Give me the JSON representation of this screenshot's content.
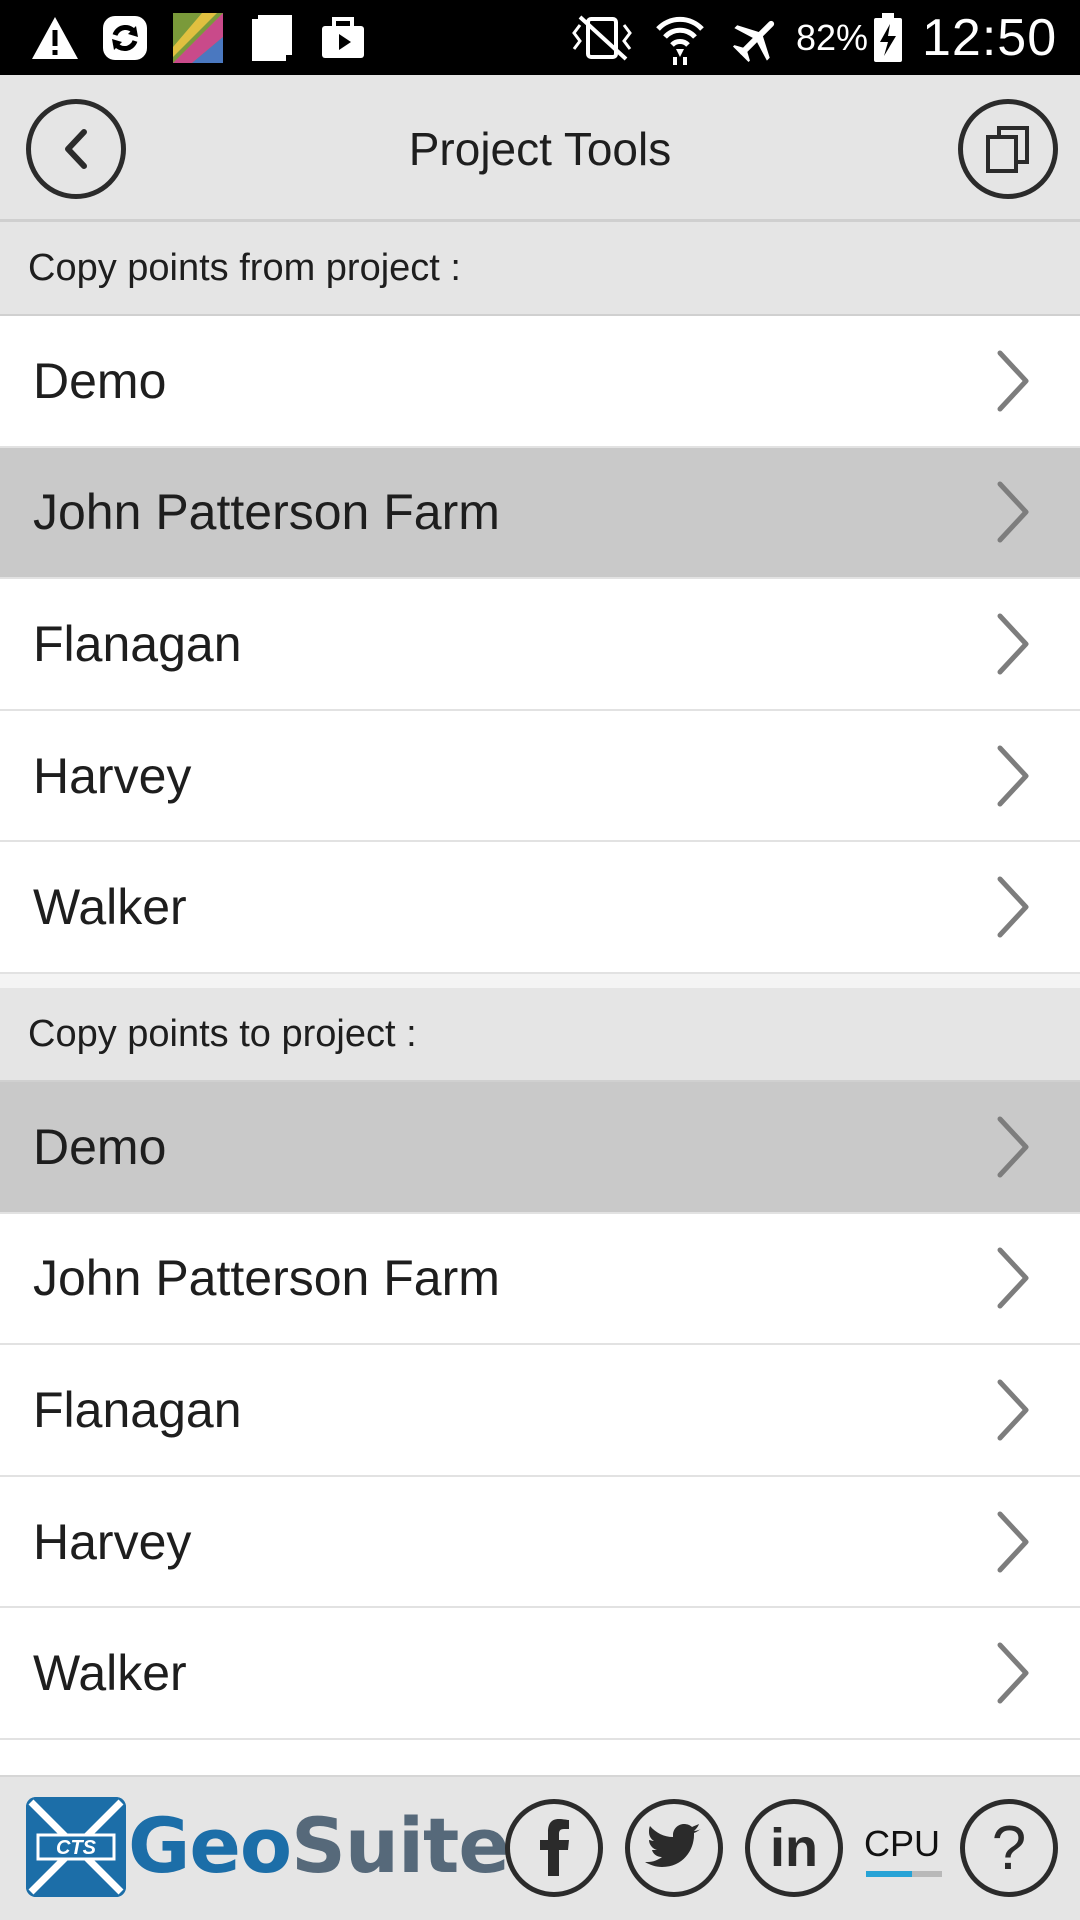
{
  "status_bar": {
    "battery_percent": "82%",
    "time": "12:50"
  },
  "header": {
    "title": "Project Tools"
  },
  "copy_from": {
    "heading": "Copy points from project :",
    "selected_index": 1,
    "items": [
      {
        "label": "Demo"
      },
      {
        "label": "John Patterson Farm"
      },
      {
        "label": "Flanagan"
      },
      {
        "label": "Harvey"
      },
      {
        "label": "Walker"
      }
    ]
  },
  "copy_to": {
    "heading": "Copy points to project :",
    "selected_index": 0,
    "items": [
      {
        "label": "Demo"
      },
      {
        "label": "John Patterson Farm"
      },
      {
        "label": "Flanagan"
      },
      {
        "label": "Harvey"
      },
      {
        "label": "Walker"
      }
    ]
  },
  "footer": {
    "brand_part1": "Geo",
    "brand_part2": "Suite",
    "linkedin_label": "in",
    "cpu_label": "CPU",
    "cpu_level": 0.6,
    "help_label": "?"
  },
  "colors": {
    "brand_blue": "#1c6ea8",
    "brand_gray": "#56697a",
    "header_bg": "#e5e5e5",
    "selected_row": "#c9c9c9",
    "cpu_fill": "#27a3d6"
  },
  "icons": {
    "status_left": [
      "warning-icon",
      "sync-icon",
      "gallery-icon",
      "clipboard-icon",
      "briefcase-icon"
    ],
    "status_right": [
      "vibrate-icon",
      "wifi-icon",
      "airplane-icon",
      "battery-icon"
    ],
    "header_left": "chevron-left-icon",
    "header_right": "copy-icon",
    "row": "chevron-right-icon",
    "footer": [
      "facebook-icon",
      "twitter-icon",
      "linkedin-icon",
      "help-icon"
    ]
  }
}
